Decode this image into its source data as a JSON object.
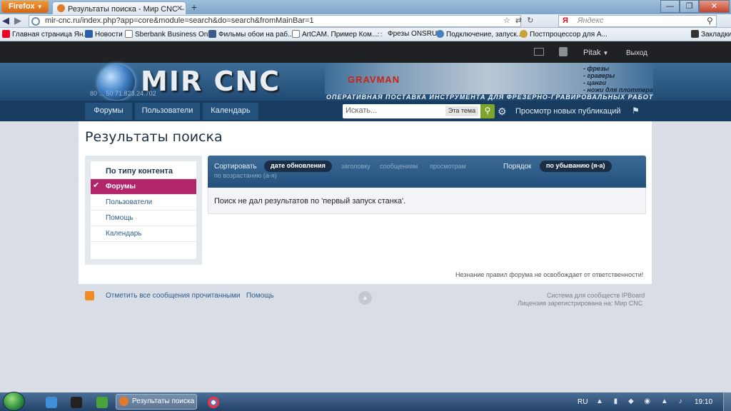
{
  "browser": {
    "menu_button": "Firefox",
    "tab_title": "Результаты поиска - Мир CNC – фору...",
    "url": "mir-cnc.ru/index.php?app=core&module=search&do=search&fromMainBar=1",
    "search_engine_placeholder": "Яндекс",
    "search_engine_mark": "Я",
    "bookmarks": [
      "Главная страница Ян...",
      "Новости",
      "Sberbank Business Onl...",
      "Фильмы обои на раб...",
      "ArtCAM. Пример Ком...",
      "Фрезы ONSRUD",
      "Подключение, запуск...",
      "Постпроцессор для А..."
    ],
    "bookmarks_menu": "Закладки"
  },
  "site": {
    "user_name": "Pitak",
    "logout": "Выход",
    "logo_text": "MIR CNC",
    "banner_phone": "80 ... 50  71.823.24.702",
    "banner_brand": "GRAVMAN",
    "banner_list": [
      "- фрезы",
      "- граверы",
      "- цанги",
      "- ножи для плоттера"
    ],
    "banner_slogan": "ОПЕРАТИВНАЯ ПОСТАВКА ИНСТРУМЕНТА ДЛЯ ФРЕЗЕРНО-ГРАВИРОВАЛЬНЫХ РАБОТ",
    "nav": {
      "forums": "Форумы",
      "users": "Пользователи",
      "calendar": "Календарь",
      "search_placeholder": "Искать...",
      "search_scope": "Эта тема",
      "new_posts": "Просмотр новых публикаций"
    }
  },
  "page": {
    "title": "Результаты поиска",
    "sidebar": {
      "header": "По типу контента",
      "items": [
        "Форумы",
        "Пользователи",
        "Помощь",
        "Календарь"
      ]
    },
    "sort": {
      "label": "Сортировать",
      "options": [
        "дате обновления",
        "заголовку",
        "сообщениям",
        "просмотрам"
      ],
      "order_label": "Порядок",
      "order_desc": "по убыванию (я-а)",
      "order_asc": "по возрастанию (а-я)"
    },
    "no_results": "Поиск не дал результатов по 'первый запуск станка'.",
    "disclaimer": "Незнание правил форума не освобождает от ответственности!"
  },
  "footer": {
    "mark_read": "Отметить все сообщения прочитанными",
    "help": "Помощь",
    "powered": "Система для сообществ IPBoard",
    "license": "Лицензия зарегистрирована на: Мир CNC"
  },
  "taskbar": {
    "firefox_item": "Результаты поиска ...",
    "language": "RU",
    "clock": "19:10"
  },
  "colors": {
    "accent_magenta": "#b2256a",
    "nav_blue": "#193d61",
    "search_green": "#7ba62b"
  }
}
